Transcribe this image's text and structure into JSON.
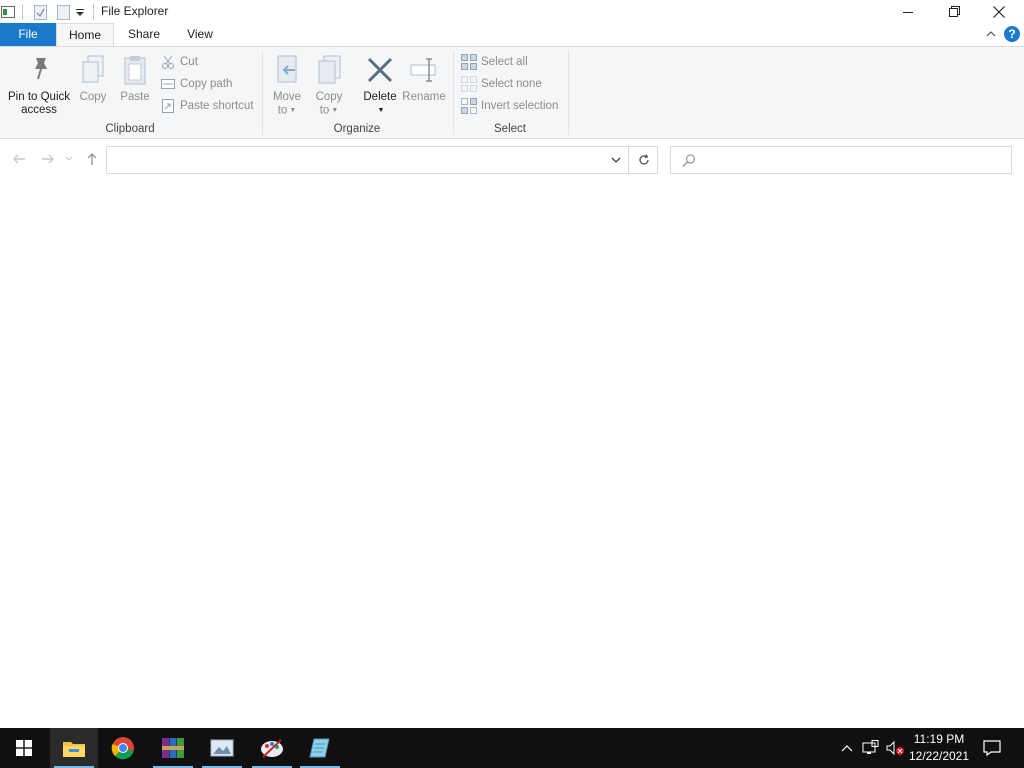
{
  "window": {
    "title": "File Explorer"
  },
  "tabs": {
    "file": "File",
    "home": "Home",
    "share": "Share",
    "view": "View"
  },
  "ribbon": {
    "clipboard": {
      "label": "Clipboard",
      "pin_line1": "Pin to Quick",
      "pin_line2": "access",
      "copy": "Copy",
      "paste": "Paste",
      "cut": "Cut",
      "copy_path": "Copy path",
      "paste_shortcut": "Paste shortcut"
    },
    "organize": {
      "label": "Organize",
      "move_line1": "Move",
      "move_line2": "to",
      "copy_line1": "Copy",
      "copy_line2": "to",
      "delete": "Delete",
      "rename": "Rename"
    },
    "select": {
      "label": "Select",
      "select_all": "Select all",
      "select_none": "Select none",
      "invert_selection": "Invert selection"
    }
  },
  "address": {
    "value": "",
    "placeholder": ""
  },
  "search": {
    "value": "",
    "placeholder": ""
  },
  "clock": {
    "time": "11:19 PM",
    "date": "12/22/2021"
  },
  "colors": {
    "accent": "#1979ca",
    "taskbar": "#101010",
    "ribbon_bg": "#f5f6f7"
  },
  "icons": {
    "taskbar": [
      "windows-start-icon",
      "file-explorer-icon",
      "chrome-icon",
      "winrar-icon",
      "image-viewer-icon",
      "paint-icon",
      "notepad-icon"
    ],
    "tray": [
      "show-hidden-icons-icon",
      "network-icon",
      "volume-muted-icon",
      "action-center-icon"
    ]
  }
}
